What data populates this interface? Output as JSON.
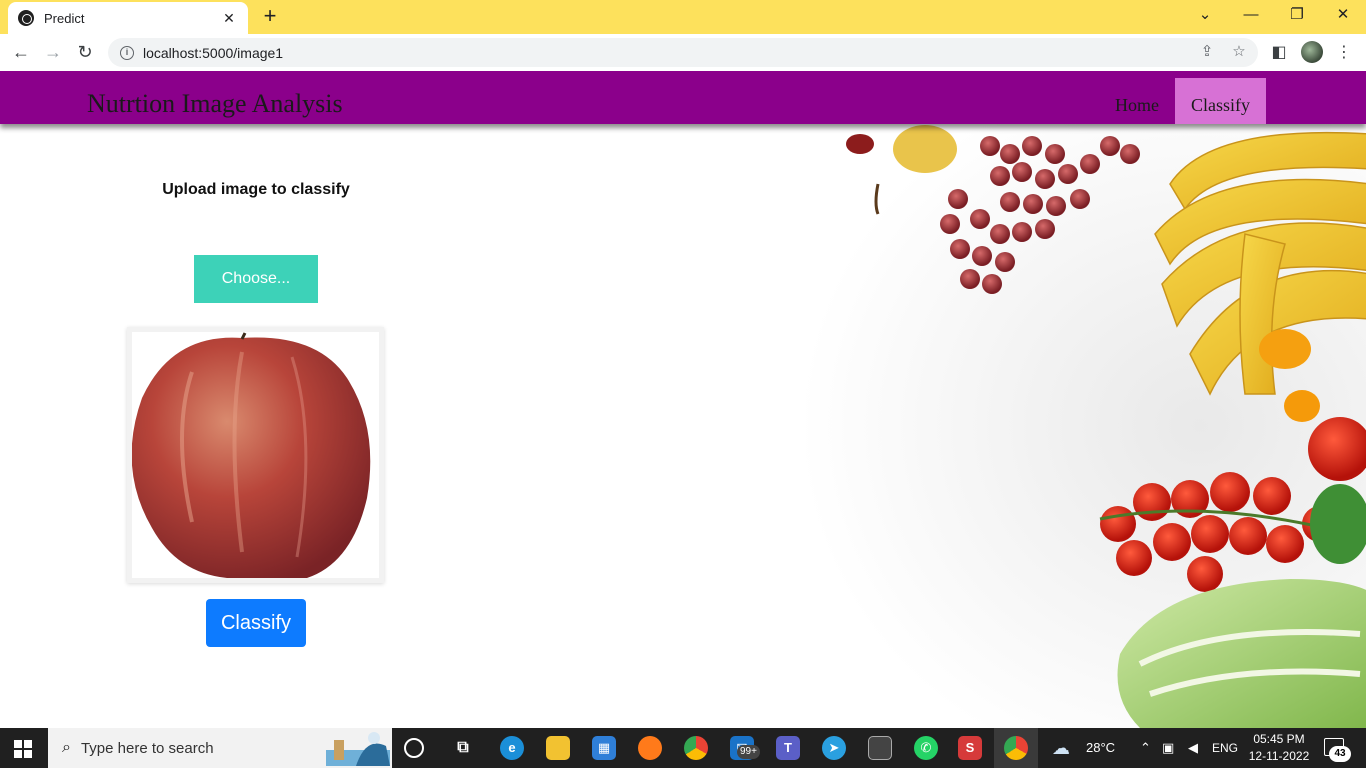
{
  "browser": {
    "tab_title": "Predict",
    "tab_close": "✕",
    "new_tab": "+",
    "url": "localhost:5000/image1",
    "controls": {
      "chevron": "⌄",
      "minimize": "—",
      "restore": "❐",
      "close": "✕"
    }
  },
  "app": {
    "brand": "Nutrtion Image Analysis",
    "nav": [
      {
        "label": "Home",
        "active": false
      },
      {
        "label": "Classify",
        "active": true
      }
    ],
    "heading": "Upload image to classify",
    "choose_label": "Choose...",
    "classify_label": "Classify"
  },
  "taskbar": {
    "search_placeholder": "Type here to search",
    "mail_badge": "99+",
    "weather": "28°C",
    "language": "ENG",
    "time": "05:45 PM",
    "date": "12-11-2022",
    "notification_count": "43"
  },
  "colors": {
    "tab_strip": "#fde15c",
    "navbar": "#8b008b",
    "nav_active": "#d771d5",
    "choose_button": "#3dd2b8",
    "classify_button": "#0d7bff"
  }
}
